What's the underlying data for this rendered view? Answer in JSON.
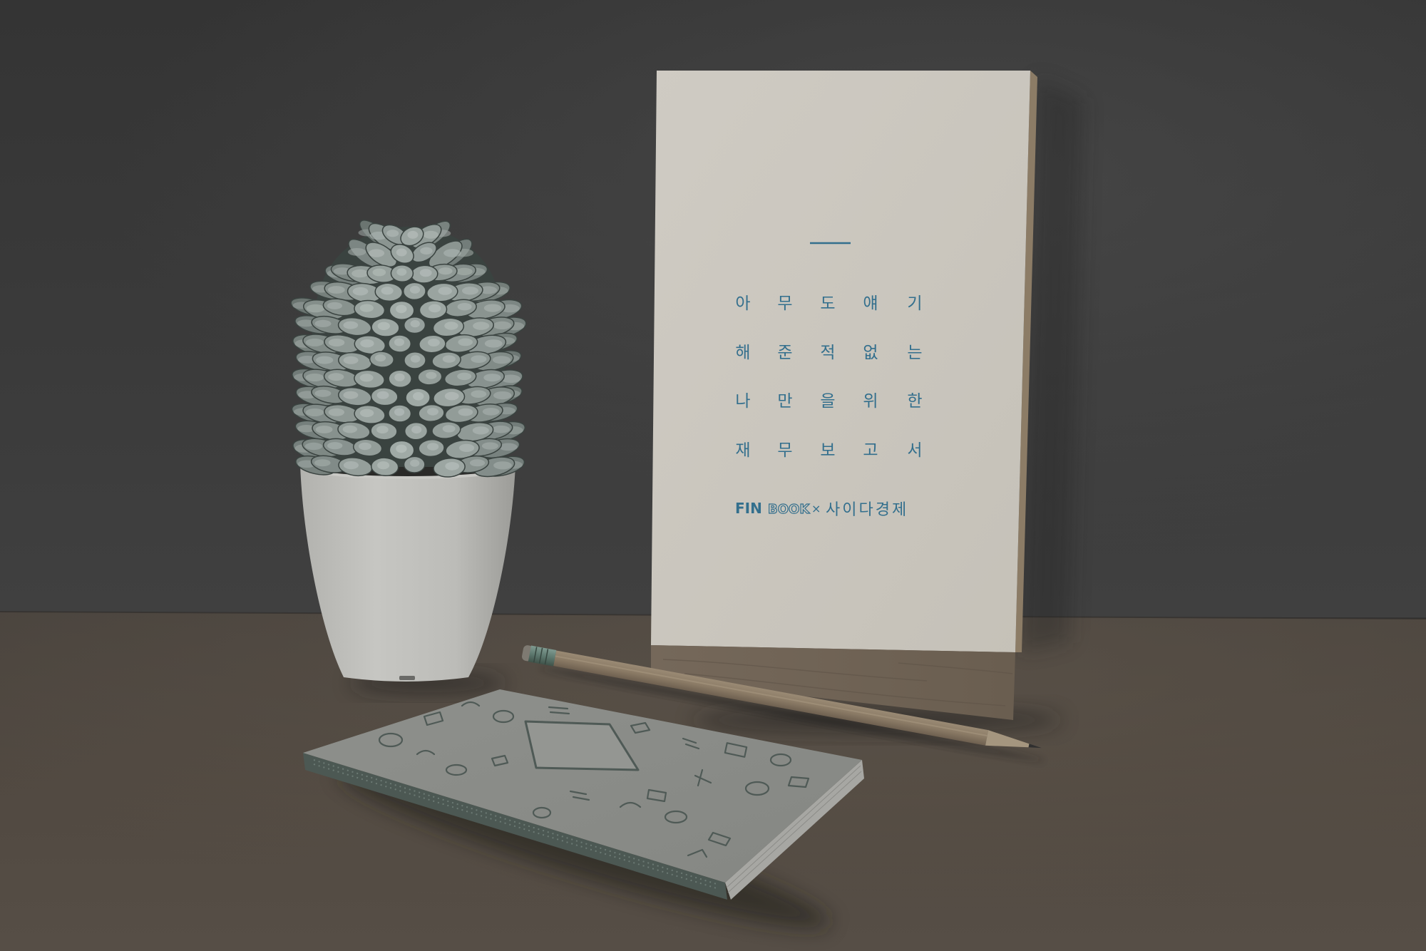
{
  "book": {
    "lines": [
      [
        "아",
        "무",
        "도",
        "얘",
        "기"
      ],
      [
        "해",
        "준",
        "적",
        "없",
        "는"
      ],
      [
        "나",
        "만",
        "을",
        "위",
        "한"
      ],
      [
        "재",
        "무",
        "보",
        "고",
        "서"
      ]
    ],
    "logo": {
      "fin": "FIN",
      "book": "BOOK",
      "times": "×",
      "partner": "사이다경제"
    }
  },
  "colors": {
    "wall": "#3a3a3a",
    "table": "#4f4842",
    "book_cover": "#cdc9c1",
    "title_text": "#336f8d",
    "cactus": "#7a8683",
    "pot": "#bdbdb9",
    "pencil_wood": "#8b7b66",
    "notebook_cover": "#8b8d89"
  }
}
